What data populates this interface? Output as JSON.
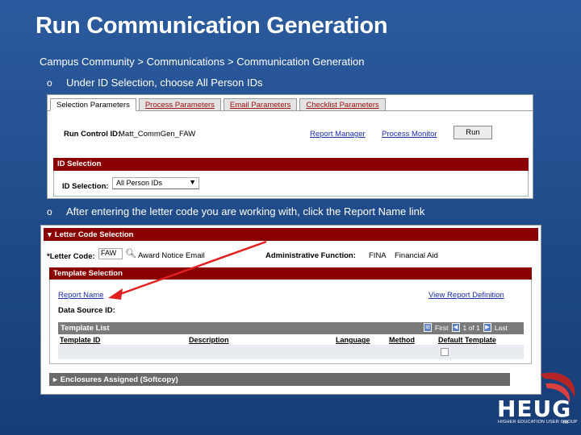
{
  "slide": {
    "title": "Run Communication Generation",
    "breadcrumb": "Campus Community > Communications > Communication Generation",
    "bullets": [
      {
        "marker": "o",
        "text": "Under ID Selection, choose All Person IDs"
      },
      {
        "marker": "o",
        "text": "After entering the letter code you are working with, click the Report Name link"
      }
    ]
  },
  "shot1": {
    "tabs": [
      "Selection Parameters",
      "Process Parameters",
      "Email Parameters",
      "Checklist Parameters"
    ],
    "run_control_label": "Run Control ID:",
    "run_control_value": "Matt_CommGen_FAW",
    "report_manager": "Report Manager",
    "process_monitor": "Process Monitor",
    "run_label": "Run",
    "id_selection_title": "ID Selection",
    "id_selection_label": "ID Selection:",
    "id_selection_value": "All Person IDs"
  },
  "shot2": {
    "letter_code_section": "Letter Code Selection",
    "letter_code_label": "*Letter Code:",
    "letter_code_value": "FAW",
    "letter_code_desc": "Award Notice Email",
    "admin_function_label": "Administrative Function:",
    "admin_function_code": "FINA",
    "admin_function_desc": "Financial Aid",
    "template_selection": "Template Selection",
    "report_name": "Report Name",
    "view_report_definition": "View Report Definition",
    "data_source_label": "Data Source ID:",
    "template_list": "Template List",
    "nav_first": "First",
    "nav_range": "1 of 1",
    "nav_last": "Last",
    "columns": [
      "Template ID",
      "Description",
      "Language",
      "Method",
      "Default Template"
    ],
    "enclosures": "Enclosures Assigned (Softcopy)"
  },
  "logo": {
    "name": "HEUG",
    "subtitle": "HIGHER EDUCATION USER GROUP",
    "tm": "TM"
  },
  "colors": {
    "background": "#2b5b9e",
    "section_bar": "#8a0000",
    "arrow": "#e02020",
    "link": "#1a2ea8"
  }
}
